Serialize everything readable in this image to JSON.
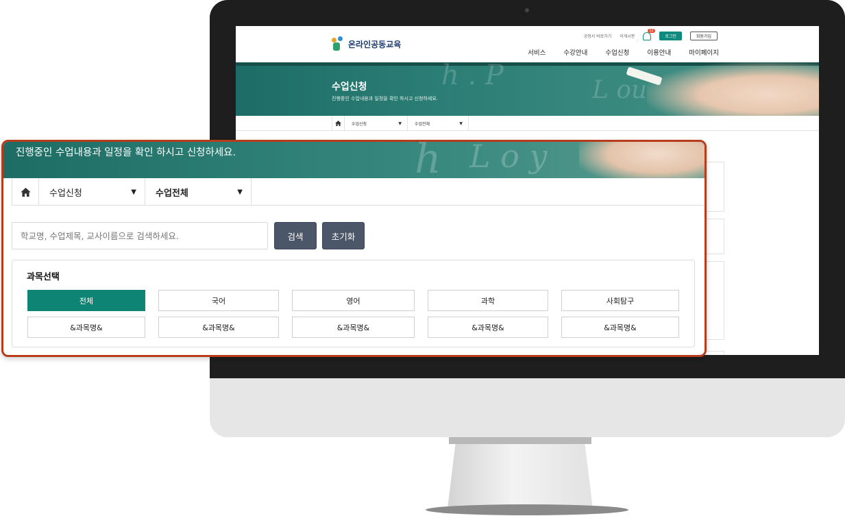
{
  "colors": {
    "accent_teal": "#0d8474",
    "button_slate": "#4b5669",
    "panel_border": "#b83c1c",
    "banner_teal": "#2a7b72"
  },
  "mini_site": {
    "logo_text": "온라인공동교육",
    "util_links": [
      "공정서 바로가기",
      "이게시판"
    ],
    "notification_count": "12",
    "login_label": "로그인",
    "join_label": "회원가입",
    "nav_items": [
      "서비스",
      "수강안내",
      "수업신청",
      "이용안내",
      "마이페이지"
    ],
    "banner_title": "수업신청",
    "banner_subtitle": "진행중인 수업내용과 일정을 확인 하시고 신청하세요.",
    "crumb_select_1": "수업신청",
    "crumb_select_2": "수업전체"
  },
  "zoom": {
    "banner_text": "진행중인 수업내용과 일정을 확인 하시고 신청하세요.",
    "crumb_select_1": "수업신청",
    "crumb_select_2": "수업전체",
    "search_placeholder": "학교명, 수업제목, 교사이름으로 검색하세요.",
    "search_button": "검색",
    "reset_button": "초기화",
    "subject_title": "과목선택",
    "subjects_row1": [
      "전체",
      "국어",
      "영어",
      "과학",
      "사회탐구"
    ],
    "subjects_row2": [
      "&과목명&",
      "&과목명&",
      "&과목명&",
      "&과목명&",
      "&과목명&"
    ],
    "active_subject": "전체"
  }
}
